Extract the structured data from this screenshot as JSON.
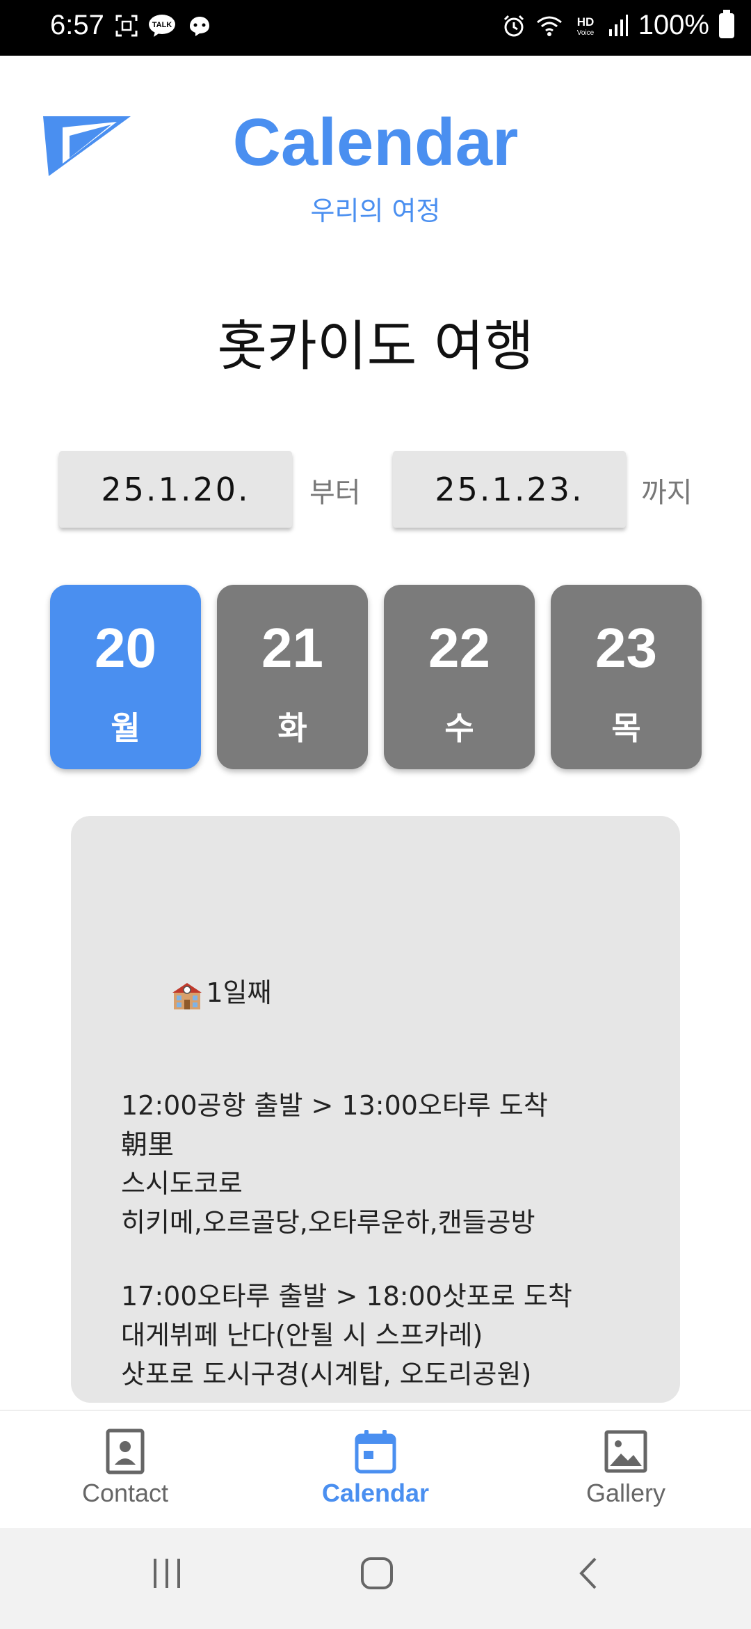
{
  "status_bar": {
    "time": "6:57",
    "battery": "100%",
    "left_icons": [
      "screenshot-icon",
      "kakaotalk-icon",
      "notification-icon"
    ],
    "right_icons": [
      "alarm-icon",
      "wifi-icon",
      "hd-voice-icon",
      "signal-icon",
      "battery-icon"
    ],
    "talk_label": "TALK",
    "hd_label": "HD",
    "voice_label": "Voice"
  },
  "header": {
    "title": "Calendar",
    "subtitle": "우리의 여정",
    "logo_icon": "paper-plane-logo",
    "accent_color": "#4a8ff0"
  },
  "trip": {
    "title": "홋카이도 여행"
  },
  "date_range": {
    "start": "25.1.20.",
    "start_suffix": "부터",
    "end": "25.1.23.",
    "end_suffix": "까지"
  },
  "days": [
    {
      "num": "20",
      "dow": "월",
      "active": true
    },
    {
      "num": "21",
      "dow": "화",
      "active": false
    },
    {
      "num": "22",
      "dow": "수",
      "active": false
    },
    {
      "num": "23",
      "dow": "목",
      "active": false
    }
  ],
  "schedule": {
    "heading": "1일째",
    "heading_icon": "school-icon",
    "block1": [
      "12:00공항 출발 > 13:00오타루 도착",
      "朝里",
      "스시도코로",
      "히키메,오르골당,오타루운하,캔들공방"
    ],
    "block2": [
      "17:00오타루 출발 > 18:00삿포로 도착",
      "대게뷔페 난다(안될 시 스프카레)",
      "삿포로 도시구경(시계탑, 오도리공원)"
    ]
  },
  "bottom_nav": [
    {
      "label": "Contact",
      "icon": "contact-icon",
      "active": false
    },
    {
      "label": "Calendar",
      "icon": "calendar-icon",
      "active": true
    },
    {
      "label": "Gallery",
      "icon": "gallery-icon",
      "active": false
    }
  ],
  "system_nav": [
    "recents-icon",
    "home-icon",
    "back-icon"
  ]
}
